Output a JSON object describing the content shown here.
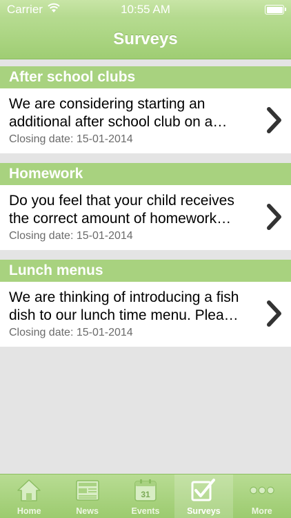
{
  "status_bar": {
    "carrier": "Carrier",
    "time": "10:55 AM"
  },
  "nav": {
    "title": "Surveys"
  },
  "surveys": [
    {
      "category": "After school clubs",
      "description": "We are considering starting an additional after school club on a…",
      "closing": "Closing date: 15-01-2014"
    },
    {
      "category": "Homework",
      "description": "Do you feel that your child receives the correct amount of homework…",
      "closing": "Closing date: 15-01-2014"
    },
    {
      "category": "Lunch menus",
      "description": "We are thinking of introducing a fish dish to our lunch time menu.  Plea…",
      "closing": "Closing date: 15-01-2014"
    }
  ],
  "tabs": [
    {
      "label": "Home",
      "icon": "home-icon"
    },
    {
      "label": "News",
      "icon": "news-icon"
    },
    {
      "label": "Events",
      "icon": "calendar-icon",
      "icon_text": "31"
    },
    {
      "label": "Surveys",
      "icon": "checkbox-icon",
      "active": true
    },
    {
      "label": "More",
      "icon": "more-icon"
    }
  ],
  "colors": {
    "header": "#a8d27f",
    "accent": "#9fcd73"
  }
}
